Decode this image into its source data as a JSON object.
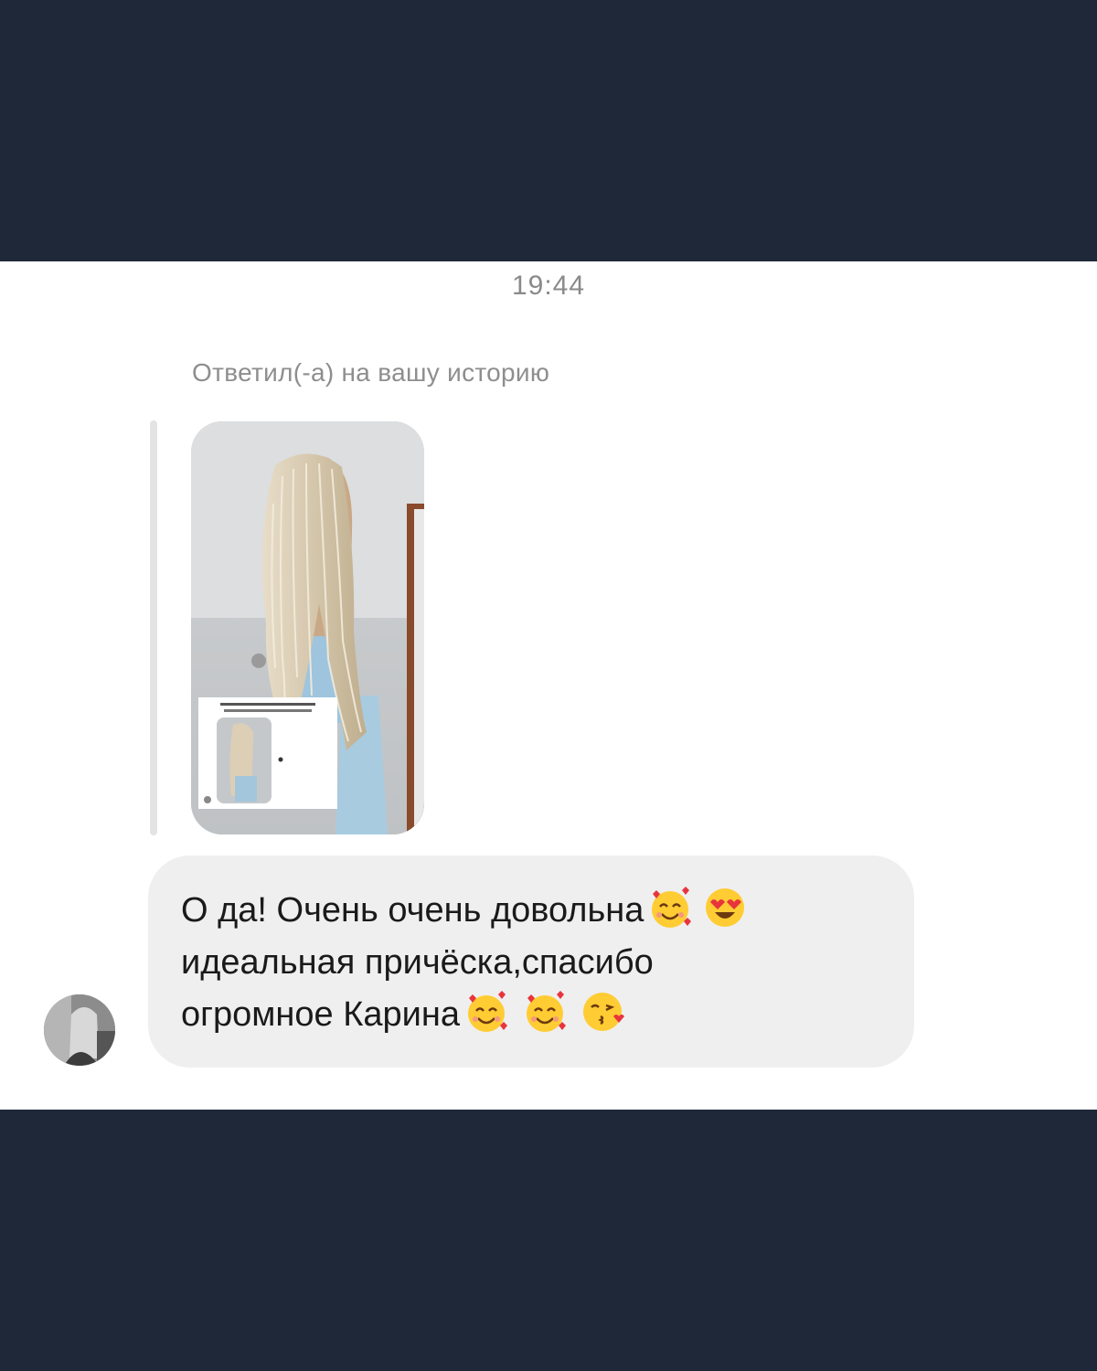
{
  "chat": {
    "timestamp": "19:44",
    "reply_context": "Ответил(-а) на вашу историю",
    "message": {
      "line1": "О да! Очень очень довольна",
      "line2": "идеальная причёска,спасибо",
      "line3": "огромное Карина",
      "line1_emojis": [
        "smiling-face-with-hearts",
        "heart-eyes"
      ],
      "line3_emojis": [
        "smiling-face-with-hearts",
        "smiling-face-with-hearts",
        "face-blowing-kiss"
      ]
    }
  },
  "colors": {
    "frame_band": "#1e2838",
    "bubble": "#efefef",
    "muted_text": "#8e8e8e"
  }
}
